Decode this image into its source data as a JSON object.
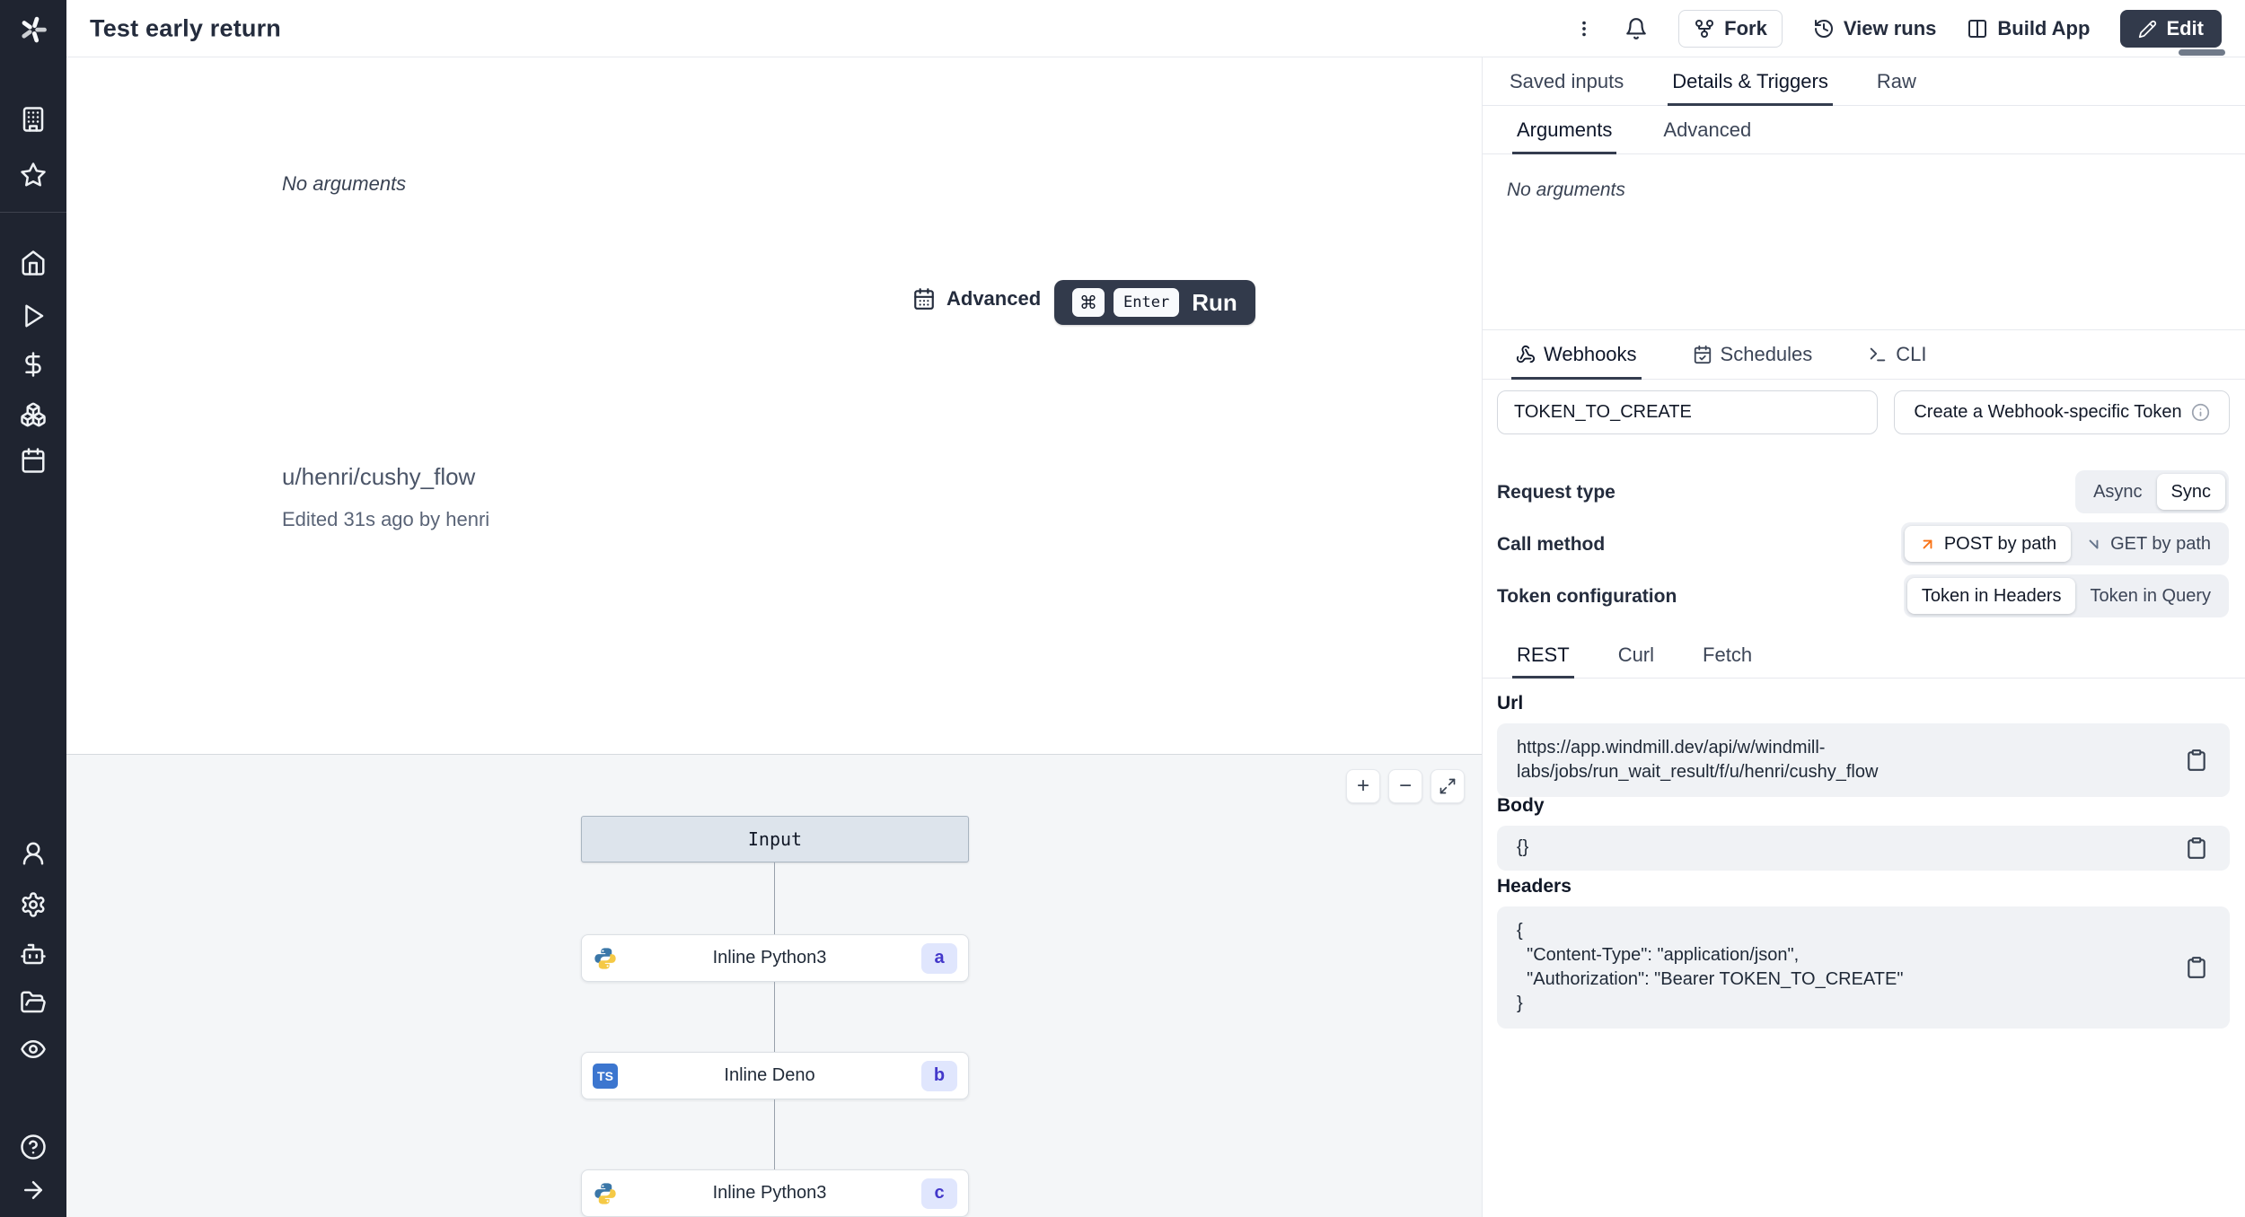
{
  "colors": {
    "sidebar_bg": "#1f2430",
    "dark_button": "#323a4b",
    "accent_orange": "#f97316",
    "badge_bg": "#e0e6fd",
    "badge_text": "#4338ca",
    "flow_bg": "#f4f6f8"
  },
  "header": {
    "title": "Test early return",
    "fork_label": "Fork",
    "view_runs_label": "View runs",
    "build_app_label": "Build App",
    "edit_label": "Edit"
  },
  "main": {
    "no_arguments": "No arguments",
    "advanced_label": "Advanced",
    "run": {
      "cmd_key": "⌘",
      "enter_key": "Enter",
      "label": "Run"
    },
    "flow_path": "u/henri/cushy_flow",
    "edited_info": "Edited 31s ago by henri"
  },
  "graph": {
    "zoom_in_label": "+",
    "zoom_out_label": "−",
    "input_label": "Input",
    "node_a": {
      "label": "Inline Python3",
      "badge": "a",
      "lang": "python"
    },
    "node_b": {
      "label": "Inline Deno",
      "badge": "b",
      "lang": "typescript",
      "icon_text": "TS"
    },
    "node_c": {
      "label": "Inline Python3",
      "badge": "c",
      "lang": "python"
    }
  },
  "panel": {
    "tabs": {
      "saved_inputs": "Saved inputs",
      "details_triggers": "Details & Triggers",
      "raw": "Raw"
    },
    "subtabs": {
      "arguments": "Arguments",
      "advanced": "Advanced"
    },
    "no_arguments": "No arguments",
    "triggers": {
      "webhooks": "Webhooks",
      "schedules": "Schedules",
      "cli": "CLI"
    },
    "webhook": {
      "token_value": "TOKEN_TO_CREATE",
      "create_token_label": "Create a Webhook-specific Token"
    },
    "request_type": {
      "label": "Request type",
      "async_label": "Async",
      "sync_label": "Sync"
    },
    "call_method": {
      "label": "Call method",
      "post_label": "POST by path",
      "get_label": "GET by path"
    },
    "token_config": {
      "label": "Token configuration",
      "headers_label": "Token in Headers",
      "query_label": "Token in Query"
    },
    "code_tabs": {
      "rest": "REST",
      "curl": "Curl",
      "fetch": "Fetch"
    },
    "url": {
      "label": "Url",
      "value": "https://app.windmill.dev/api/w/windmill-labs/jobs/run_wait_result/f/u/henri/cushy_flow"
    },
    "body": {
      "label": "Body",
      "value": "{}"
    },
    "headers": {
      "label": "Headers",
      "value": "{\n  \"Content-Type\": \"application/json\",\n  \"Authorization\": \"Bearer TOKEN_TO_CREATE\"\n}"
    }
  },
  "icons": [
    "windmill-logo",
    "building-icon",
    "star-icon",
    "home-icon",
    "play-icon",
    "dollar-icon",
    "boxes-icon",
    "calendar-icon",
    "user-icon",
    "gear-icon",
    "bot-icon",
    "folder-icon",
    "eye-icon",
    "help-icon",
    "arrow-right-icon",
    "kebab-menu-icon",
    "bell-icon",
    "fork-icon",
    "history-icon",
    "columns-icon",
    "pencil-icon",
    "webhook-icon",
    "calendar-check-icon",
    "terminal-icon",
    "info-icon",
    "clipboard-icon",
    "arrow-up-right-icon",
    "arrow-down-right-icon",
    "maximize-icon",
    "python-icon",
    "typescript-icon"
  ]
}
